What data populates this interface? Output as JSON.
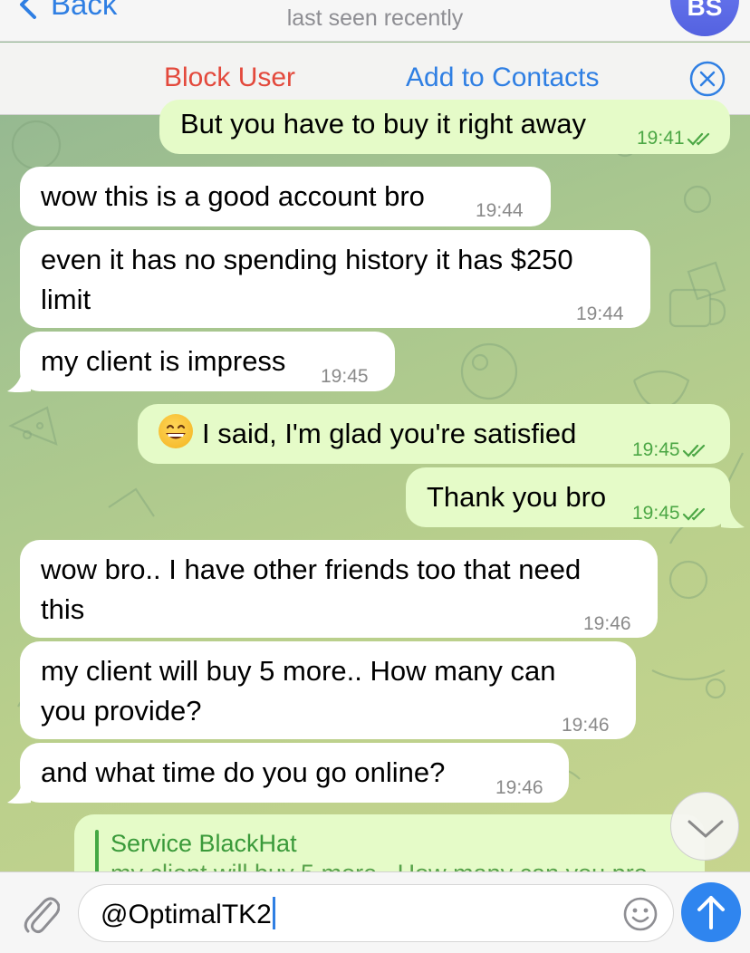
{
  "header": {
    "back_label": "Back",
    "status": "last seen recently",
    "avatar_initials": "BS",
    "accent_color": "#2f7fe3"
  },
  "action_bar": {
    "block_user": "Block User",
    "add_to_contacts": "Add to Contacts",
    "block_color": "#e3493c"
  },
  "messages": [
    {
      "dir": "out",
      "text": "But you have to buy it right away",
      "time": "19:41",
      "read": true
    },
    {
      "dir": "in",
      "text": "wow this is a good account bro",
      "time": "19:44"
    },
    {
      "dir": "in",
      "line1": "even it has no spending history it has $250",
      "line2": "limit",
      "time": "19:44"
    },
    {
      "dir": "in",
      "text": "my client is impress",
      "time": "19:45"
    },
    {
      "dir": "out",
      "emoji": "grinning-face-emoji",
      "text": "I said, I'm glad you're satisfied",
      "time": "19:45",
      "read": true
    },
    {
      "dir": "out",
      "text": "Thank you bro",
      "time": "19:45",
      "read": true
    },
    {
      "dir": "in",
      "line1": "wow bro.. I have other friends too that need",
      "line2": "this",
      "time": "19:46"
    },
    {
      "dir": "in",
      "line1": "my client will buy 5 more..  How many can",
      "line2": "you provide?",
      "time": "19:46"
    },
    {
      "dir": "in",
      "text": "and what time do you go online?",
      "time": "19:46"
    }
  ],
  "reply_preview": {
    "name": "Service BlackHat",
    "text": "my client will buy 5 more..  How many can you pro"
  },
  "composer": {
    "value": "@OptimalTK2",
    "icons": [
      "paperclip-icon",
      "smiley-icon",
      "send-arrow-icon"
    ]
  },
  "colors": {
    "incoming_bubble": "#ffffff",
    "outgoing_bubble": "#e5fbc8",
    "outgoing_time": "#4ca745",
    "send_button": "#2f85ef"
  }
}
